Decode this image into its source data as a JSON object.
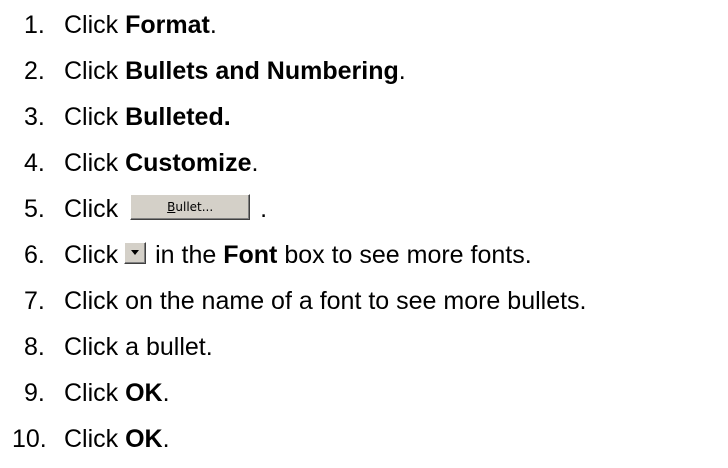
{
  "steps": [
    {
      "number": "1.",
      "prefix": "Click ",
      "bold": "Format",
      "suffix": "."
    },
    {
      "number": "2.",
      "prefix": "Click ",
      "bold": "Bullets and Numbering",
      "suffix": "."
    },
    {
      "number": "3.",
      "prefix": "Click ",
      "bold": "Bulleted.",
      "suffix": ""
    },
    {
      "number": "4.",
      "prefix": "Click ",
      "bold": "Customize",
      "suffix": "."
    },
    {
      "number": "5.",
      "prefix": "Click",
      "button_label_underlined": "B",
      "button_label_rest": "ullet...",
      "suffix": "."
    },
    {
      "number": "6.",
      "prefix": "Click",
      "icon": "dropdown-arrow-icon",
      "middle": " in the ",
      "bold": "Font",
      "suffix": " box to see more fonts."
    },
    {
      "number": "7.",
      "text": "Click on the name of a font to see more bullets."
    },
    {
      "number": "8.",
      "text": "Click a bullet."
    },
    {
      "number": "9.",
      "prefix": "Click ",
      "bold": "OK",
      "suffix": "."
    },
    {
      "number": "10.",
      "prefix": "Click ",
      "bold": "OK",
      "suffix": "."
    }
  ],
  "colors": {
    "text": "#000000",
    "button_face": "#d4d0c8"
  }
}
